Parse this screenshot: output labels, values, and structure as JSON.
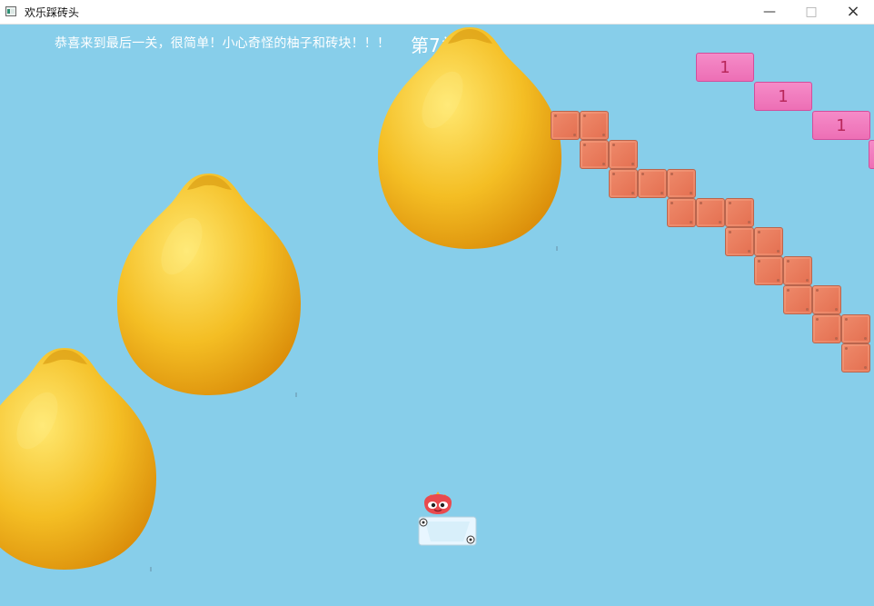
{
  "window": {
    "title": "欢乐踩砖头"
  },
  "hud": {
    "message": "恭喜来到最后一关，很简单！小心奇怪的柚子和砖块！！！",
    "level": "第7关"
  },
  "bricks": {
    "pink_label": "1"
  },
  "colors": {
    "sky": "#87ceea",
    "brick": "#e8775a",
    "pink_brick": "#f07cbc",
    "fruit": "#f2b826"
  },
  "icons": {
    "app": "app-icon",
    "minimize": "minimize-icon",
    "maximize": "maximize-icon",
    "close": "close-icon"
  }
}
